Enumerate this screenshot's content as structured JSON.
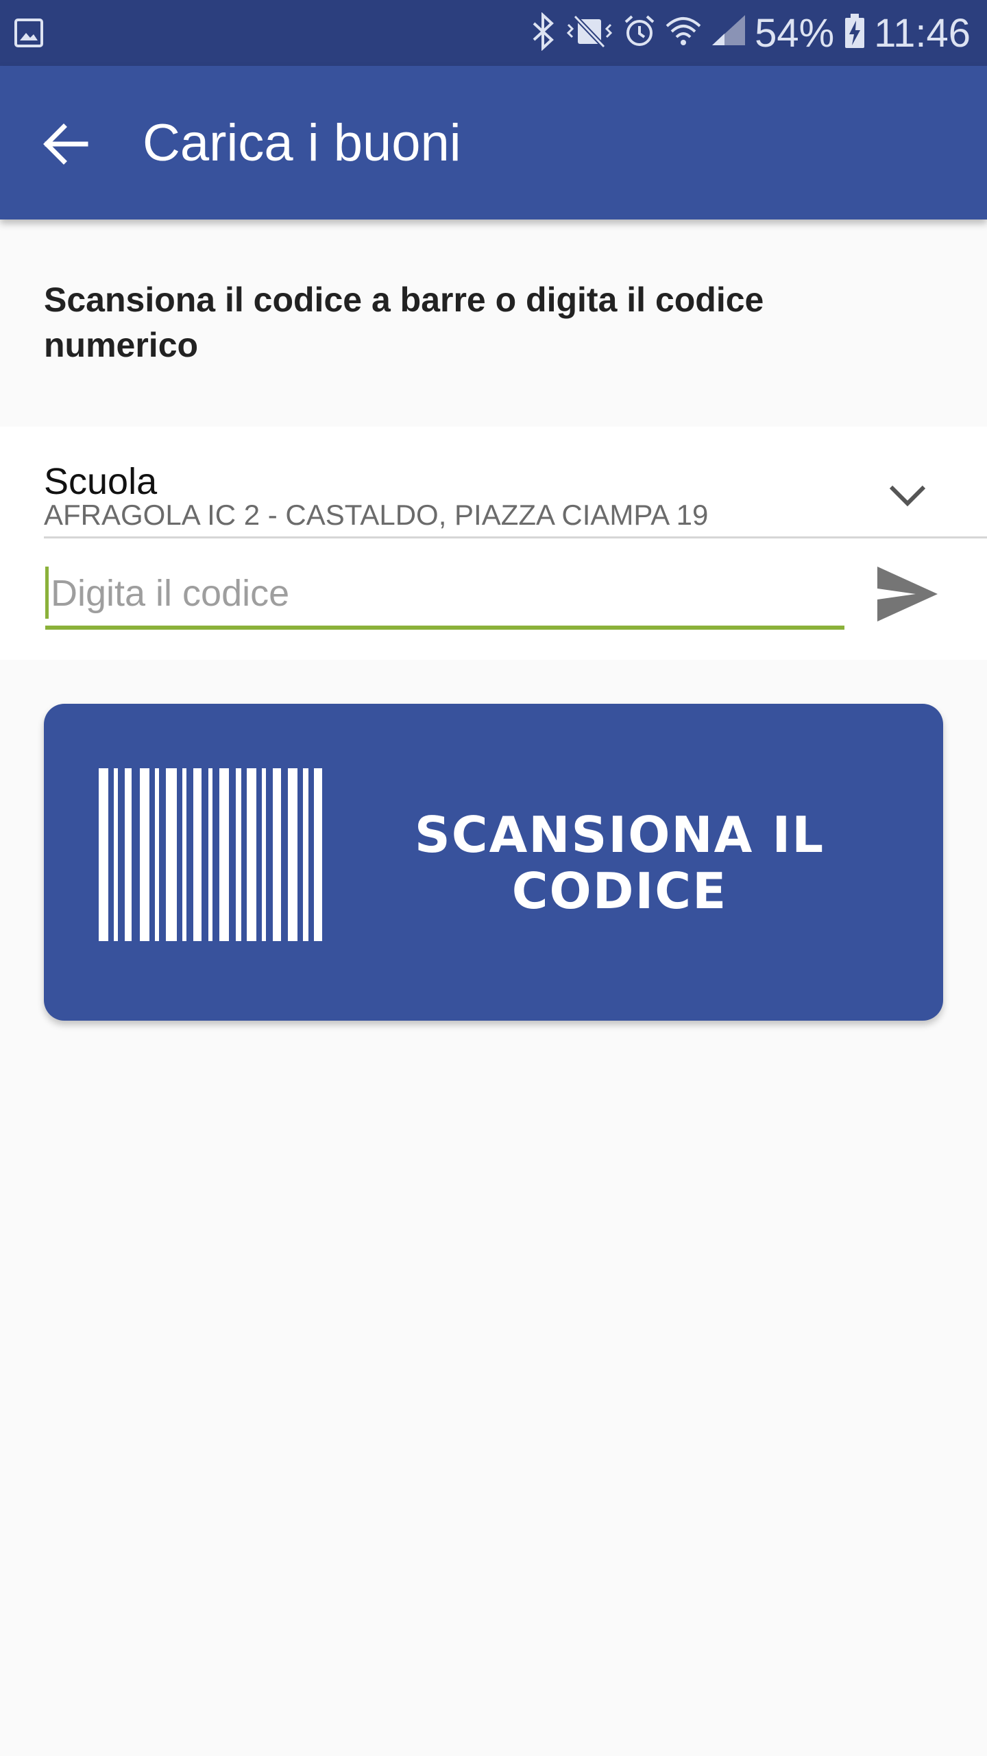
{
  "status_bar": {
    "battery": "54%",
    "time": "11:46",
    "icons": [
      "gallery-icon",
      "bluetooth-icon",
      "vibrate-icon",
      "alarm-icon",
      "wifi-icon",
      "signal-icon",
      "battery-charging-icon"
    ]
  },
  "app_bar": {
    "title": "Carica i buoni",
    "back_icon": "arrow-left-icon"
  },
  "instruction": "Scansiona il codice a barre o digita il codice numerico",
  "school_select": {
    "label": "Scuola",
    "value": "AFRAGOLA IC 2 - CASTALDO, PIAZZA CIAMPA 19",
    "icon": "chevron-down-icon"
  },
  "code_input": {
    "value": "",
    "placeholder": "Digita il codice",
    "send_icon": "send-icon"
  },
  "scan_button": {
    "label": "SCANSIONA IL CODICE",
    "icon": "barcode-icon"
  },
  "colors": {
    "status_bar": "#2c3f7e",
    "primary": "#38529c",
    "accent": "#8bb13a",
    "background": "#fafafa"
  }
}
